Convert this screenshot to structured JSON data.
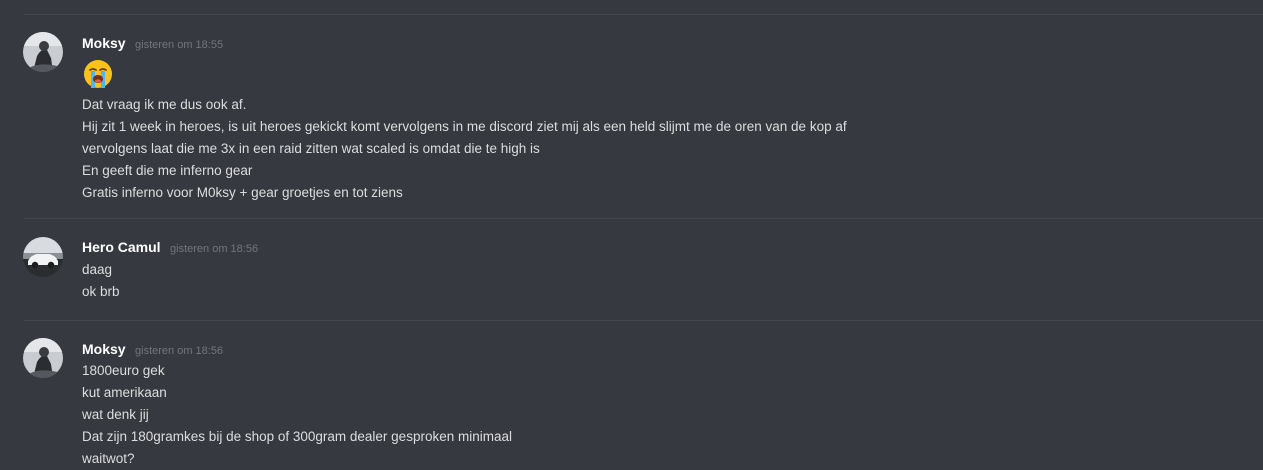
{
  "messages": [
    {
      "author": "Moksy",
      "timestamp": "gisteren om 18:55",
      "avatar_icon": "moksy-avatar",
      "emoji": "loudly-crying-face",
      "lines": [
        "Dat vraag ik me dus ook af.",
        "Hij zit 1 week in heroes, is uit heroes gekickt komt vervolgens in me discord ziet mij als een held slijmt me de oren van de kop af",
        "vervolgens laat die me 3x in een raid zitten wat scaled is omdat die te high is",
        "En geeft die me inferno gear",
        "Gratis inferno voor M0ksy + gear groetjes en tot ziens"
      ]
    },
    {
      "author": "Hero Camul",
      "timestamp": "gisteren om 18:56",
      "avatar_icon": "car-avatar",
      "lines": [
        "daag",
        "ok brb"
      ]
    },
    {
      "author": "Moksy",
      "timestamp": "gisteren om 18:56",
      "avatar_icon": "moksy-avatar",
      "lines": [
        "1800euro gek",
        "kut amerikaan",
        "wat denk jij",
        "Dat zijn 180gramkes bij de shop of 300gram dealer gesproken minimaal",
        "waitwot?"
      ]
    }
  ],
  "colors": {
    "background": "#36393f",
    "divider": "#42454a",
    "username": "#ffffff",
    "timestamp": "#72767d",
    "text": "#dcddde"
  }
}
